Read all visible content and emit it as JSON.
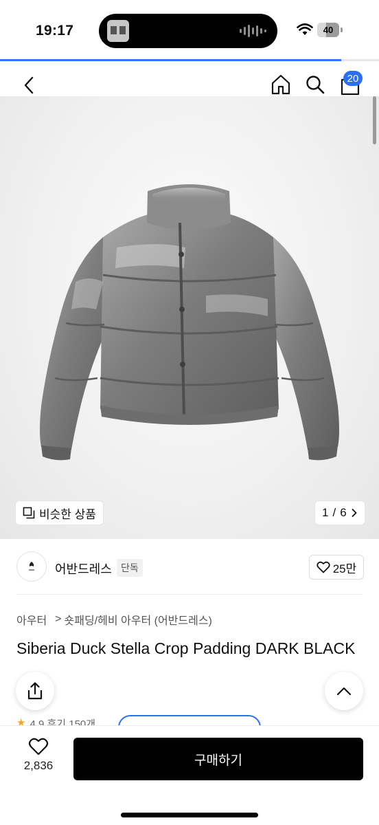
{
  "status_bar": {
    "time": "19:17",
    "battery": "40",
    "battery_level": 0.4
  },
  "page_load_progress": 0.9,
  "header": {
    "back_icon": "chevron-left-icon",
    "home_icon": "home-icon",
    "search_icon": "search-icon",
    "cart_icon": "shopping-bag-icon",
    "cart_count": "20"
  },
  "gallery": {
    "similar_label": "비슷한 상품",
    "page_current": "1",
    "page_separator": "/",
    "page_total": "6"
  },
  "brand": {
    "name": "어반드레스",
    "tag": "단독",
    "likes": "25만"
  },
  "breadcrumb": {
    "level1": "아우터",
    "separator": ">",
    "level2": "숏패딩/헤비 아우터 (어반드레스)"
  },
  "product": {
    "title": "Siberia Duck Stella Crop Padding DARK BLACK"
  },
  "rating_partial": "4.9  후기 150개",
  "bottom_bar": {
    "wish_count": "2,836",
    "buy_label": "구매하기"
  },
  "colors": {
    "accent_blue": "#2b6ff5",
    "buy_button": "#000000",
    "jacket": "#8a8a8a"
  }
}
